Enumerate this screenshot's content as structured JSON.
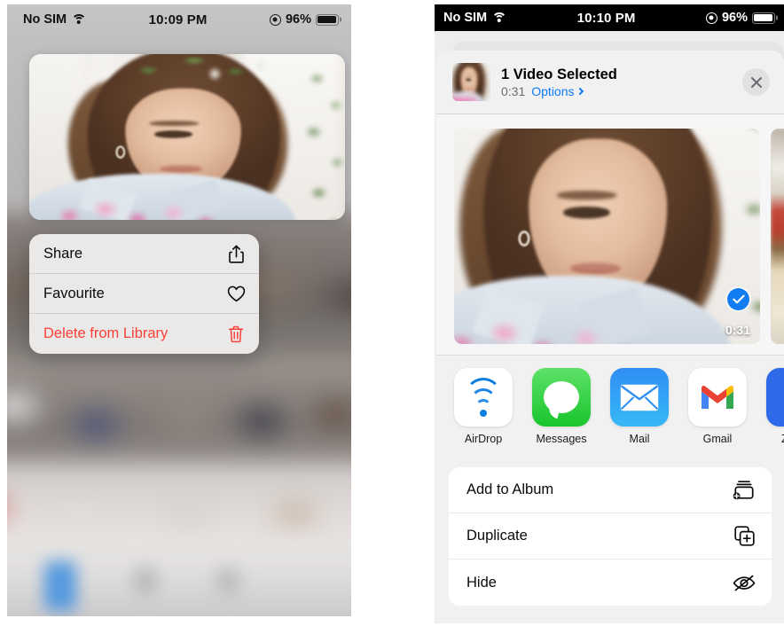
{
  "left_panel": {
    "status_bar": {
      "carrier": "No SIM",
      "wifi_icon": "wifi-icon",
      "time": "10:09 PM",
      "location_icon": "location-services-icon",
      "battery_percent": "96%",
      "battery_icon": "battery-icon"
    },
    "photo": {
      "name": "photo-preview",
      "alt": "Woman looking down at pink flowers"
    },
    "context_menu": {
      "items": [
        {
          "label": "Share",
          "icon": "share-icon",
          "danger": false
        },
        {
          "label": "Favourite",
          "icon": "heart-icon",
          "danger": false
        },
        {
          "label": "Delete from Library",
          "icon": "trash-icon",
          "danger": true
        }
      ]
    }
  },
  "right_panel": {
    "status_bar": {
      "carrier": "No SIM",
      "wifi_icon": "wifi-icon",
      "time": "10:10 PM",
      "location_icon": "location-services-icon",
      "battery_percent": "96%",
      "battery_icon": "battery-icon"
    },
    "share_sheet": {
      "header": {
        "title": "1 Video Selected",
        "duration": "0:31",
        "options_label": "Options",
        "options_chevron": "chevron-right-icon",
        "close_icon": "close-icon",
        "thumbnail": "selected-video-thumbnail"
      },
      "preview": {
        "selected_badge": "checkmark-icon",
        "duration_badge": "0:31"
      },
      "apps": [
        {
          "label": "AirDrop",
          "icon": "airdrop-icon"
        },
        {
          "label": "Messages",
          "icon": "messages-icon"
        },
        {
          "label": "Mail",
          "icon": "mail-icon"
        },
        {
          "label": "Gmail",
          "icon": "gmail-icon"
        },
        {
          "label": "Zoom",
          "icon": "zoom-icon",
          "glyph": "z"
        }
      ],
      "actions": [
        {
          "label": "Add to Album",
          "icon": "add-to-album-icon"
        },
        {
          "label": "Duplicate",
          "icon": "duplicate-icon"
        },
        {
          "label": "Hide",
          "icon": "hide-eye-icon"
        }
      ]
    }
  },
  "colors": {
    "accent_blue": "#007aff",
    "destructive_red": "#fa4038",
    "selection_blue": "#127cf3",
    "menu_background": "#ebe9e8",
    "sheet_background": "#f2f1f1"
  }
}
